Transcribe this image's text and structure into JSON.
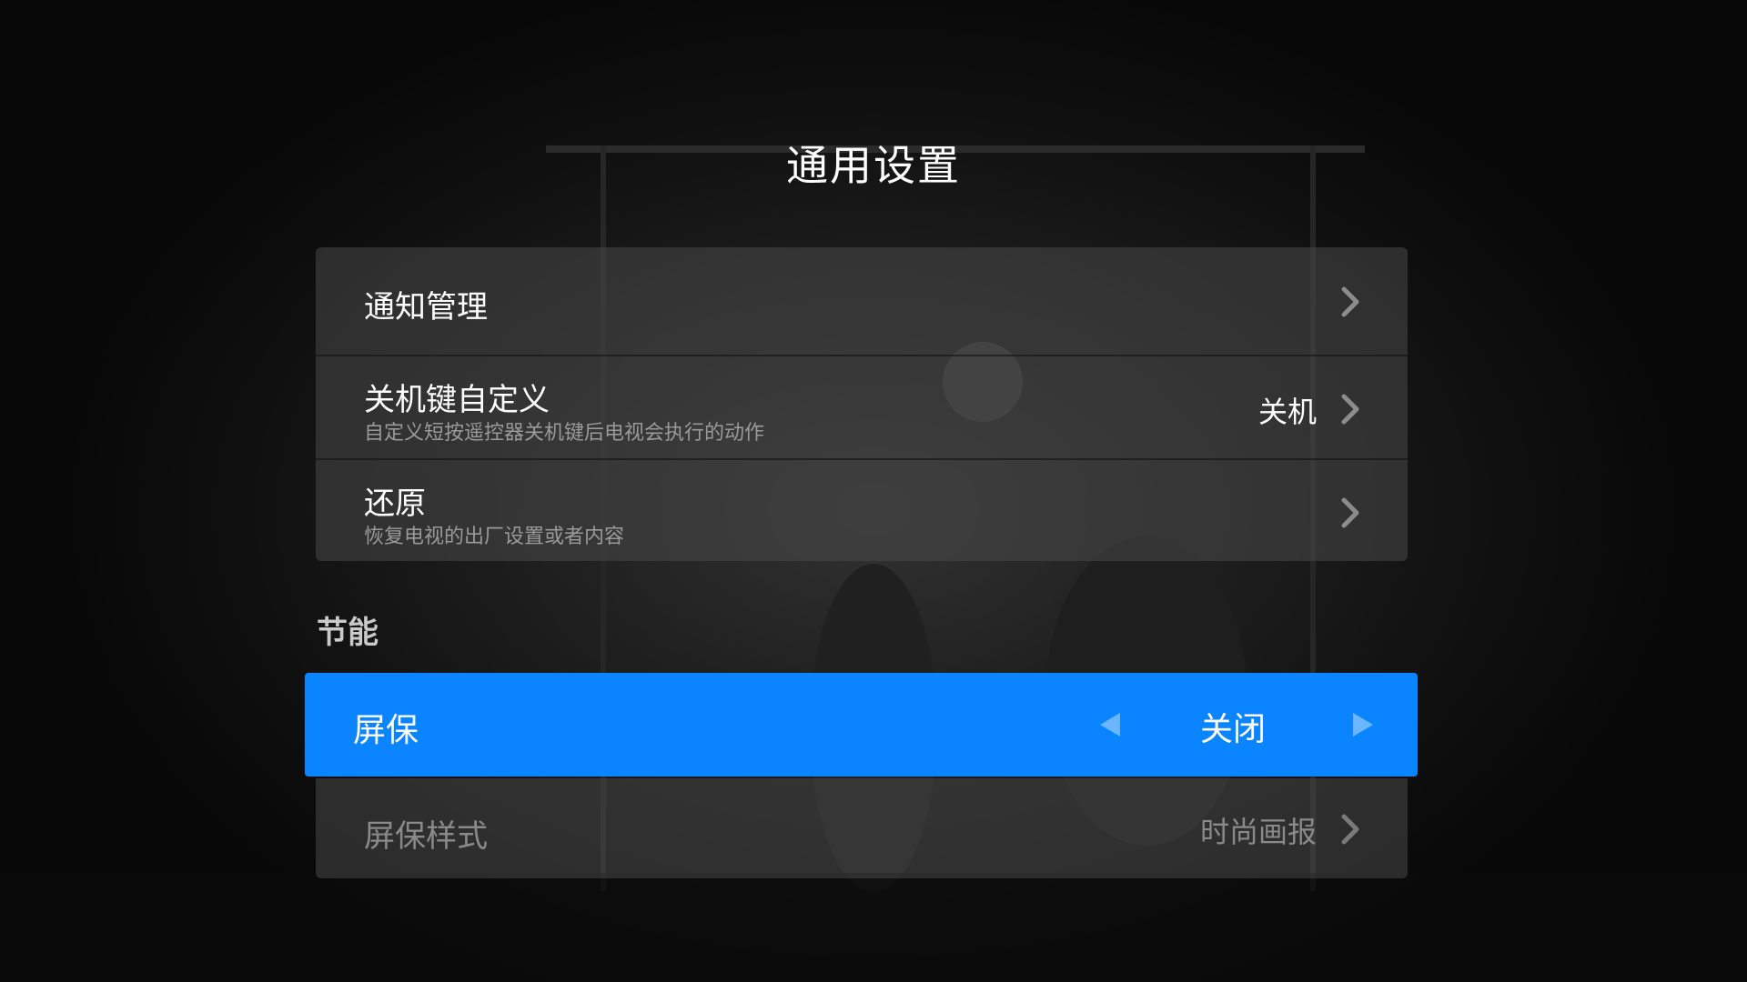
{
  "page": {
    "title": "通用设置"
  },
  "general_items": [
    {
      "label": "通知管理",
      "subtitle": "",
      "value": ""
    },
    {
      "label": "关机键自定义",
      "subtitle": "自定义短按遥控器关机键后电视会执行的动作",
      "value": "关机"
    },
    {
      "label": "还原",
      "subtitle": "恢复电视的出厂设置或者内容",
      "value": ""
    }
  ],
  "power_section": {
    "header": "节能",
    "screensaver": {
      "label": "屏保",
      "value": "关闭"
    },
    "screensaver_style": {
      "label": "屏保样式",
      "value": "时尚画报"
    }
  },
  "colors": {
    "focus": "#0a84ff",
    "panel": "#484848",
    "text": "#ffffff",
    "subtext": "#9a9a9a",
    "disabled_text": "#8a8a8a"
  },
  "icons": {
    "chevron": "chevron-right-icon",
    "left_arrow": "triangle-left-icon",
    "right_arrow": "triangle-right-icon"
  }
}
